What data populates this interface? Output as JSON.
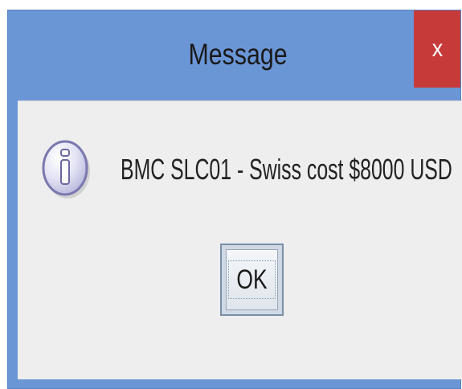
{
  "dialog": {
    "title": "Message",
    "close_label": "x",
    "icon": "info-icon",
    "message": "BMC SLC01 - Swiss cost $8000 USD",
    "ok_label": "OK"
  },
  "colors": {
    "titlebar": "#6b96d6",
    "close_button": "#c73a3a",
    "content_background": "#eeeeee"
  }
}
